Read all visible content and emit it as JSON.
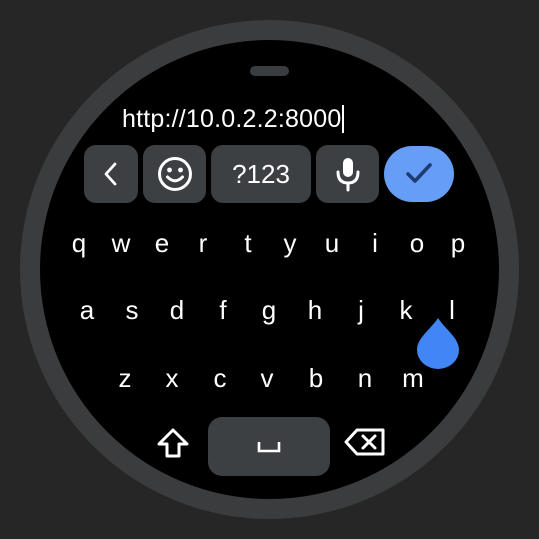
{
  "input": {
    "value": "http://10.0.2.2:8000"
  },
  "toolbar": {
    "symbols_label": "?123"
  },
  "keyboard": {
    "rows": [
      [
        "q",
        "w",
        "e",
        "r",
        "t",
        "y",
        "u",
        "i",
        "o",
        "p"
      ],
      [
        "a",
        "s",
        "d",
        "f",
        "g",
        "h",
        "j",
        "k",
        "l"
      ],
      [
        "z",
        "x",
        "c",
        "v",
        "b",
        "n",
        "m"
      ]
    ]
  },
  "colors": {
    "accent": "#669df6",
    "key_bg": "#3c4043",
    "popup": "#4285f4",
    "bezel": "#3b3c3d",
    "background": "#262626"
  },
  "icons": {
    "back": "chevron-left-icon",
    "emoji": "emoji-icon",
    "mic": "mic-icon",
    "done": "checkmark-icon",
    "shift": "shift-icon",
    "space": "space-icon",
    "backspace": "backspace-icon"
  }
}
